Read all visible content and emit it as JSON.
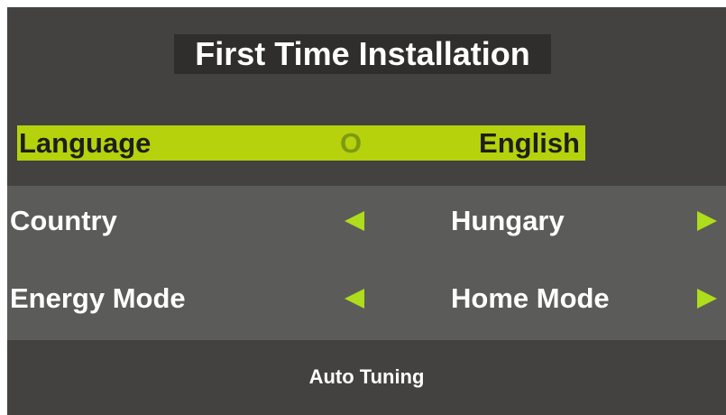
{
  "title": "First Time Installation",
  "language_row": {
    "label": "Language",
    "indicator": "O",
    "value": "English"
  },
  "country_row": {
    "label": "Country",
    "value": "Hungary",
    "left_icon": "left-triangle-arrow",
    "right_icon": "right-triangle-arrow"
  },
  "energy_row": {
    "label": "Energy Mode",
    "value": "Home Mode",
    "left_icon": "left-triangle-arrow",
    "right_icon": "right-triangle-arrow"
  },
  "auto_tuning": {
    "label": "Auto Tuning"
  },
  "colors": {
    "background": "#434241",
    "title_bg": "#2f2e2d",
    "highlight": "#b5d20c",
    "panel": "#5b5b5a",
    "arrow": "#aedd1b",
    "text": "#ffffff"
  }
}
